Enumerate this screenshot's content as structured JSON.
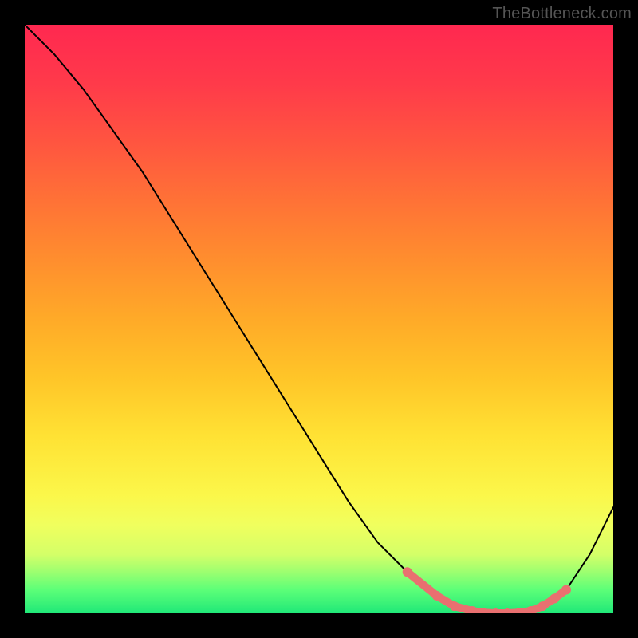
{
  "watermark": "TheBottleneck.com",
  "chart_data": {
    "type": "line",
    "title": "",
    "xlabel": "",
    "ylabel": "",
    "xlim": [
      0,
      100
    ],
    "ylim": [
      0,
      100
    ],
    "background_gradient": {
      "top": "#ff2850",
      "bottom": "#20e878",
      "stops": [
        "#ff2850",
        "#ff5540",
        "#ff8e2e",
        "#ffc528",
        "#fbf74a",
        "#9cff70",
        "#20e878"
      ]
    },
    "series": [
      {
        "name": "bottleneck-curve",
        "color": "#000000",
        "x": [
          0,
          5,
          10,
          15,
          20,
          25,
          30,
          35,
          40,
          45,
          50,
          55,
          60,
          65,
          70,
          73,
          76,
          80,
          84,
          88,
          92,
          96,
          100
        ],
        "y": [
          100,
          95,
          89,
          82,
          75,
          67,
          59,
          51,
          43,
          35,
          27,
          19,
          12,
          7,
          3,
          1,
          0,
          0,
          0,
          1,
          4,
          10,
          18
        ]
      },
      {
        "name": "optimal-zone",
        "color": "#e97070",
        "style": "thick-dots",
        "x": [
          65,
          70,
          73,
          76,
          78,
          80,
          82,
          84,
          86,
          88,
          90,
          92
        ],
        "y": [
          7,
          3,
          1.2,
          0.4,
          0.1,
          0,
          0,
          0.1,
          0.4,
          1.2,
          2.5,
          4
        ]
      }
    ],
    "annotations": []
  }
}
